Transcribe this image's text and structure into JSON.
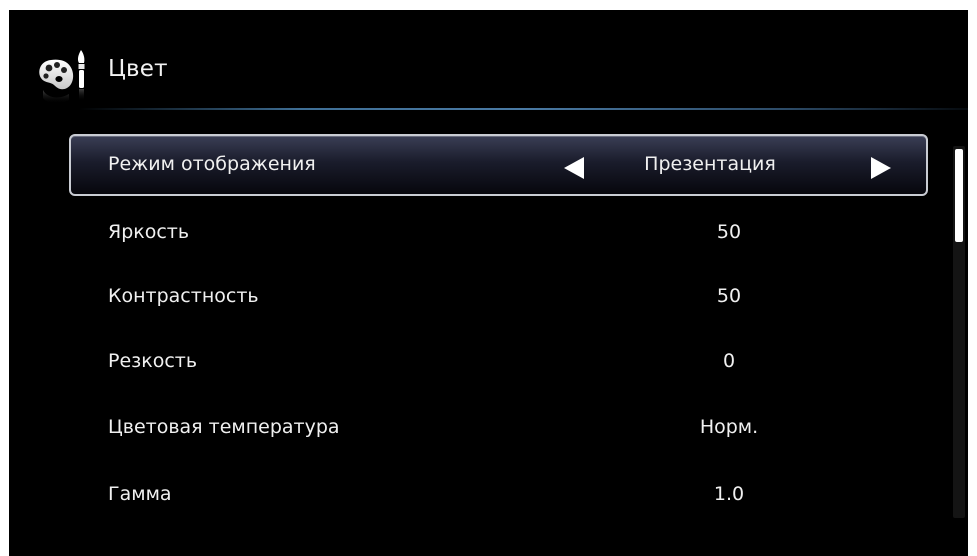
{
  "header": {
    "title": "Цвет",
    "icon": "palette-icon"
  },
  "menu": {
    "items": [
      {
        "label": "Режим отображения",
        "value": "Презентация",
        "selected": true
      },
      {
        "label": "Яркость",
        "value": "50"
      },
      {
        "label": "Контрастность",
        "value": "50"
      },
      {
        "label": "Резкость",
        "value": "0"
      },
      {
        "label": "Цветовая температура",
        "value": "Норм."
      },
      {
        "label": "Гамма",
        "value": "1.0"
      }
    ]
  },
  "colors": {
    "background": "#000000",
    "text": "#f0f0f0",
    "accent_line": "#4a7aa4",
    "selection_border": "#c9ccd3"
  }
}
